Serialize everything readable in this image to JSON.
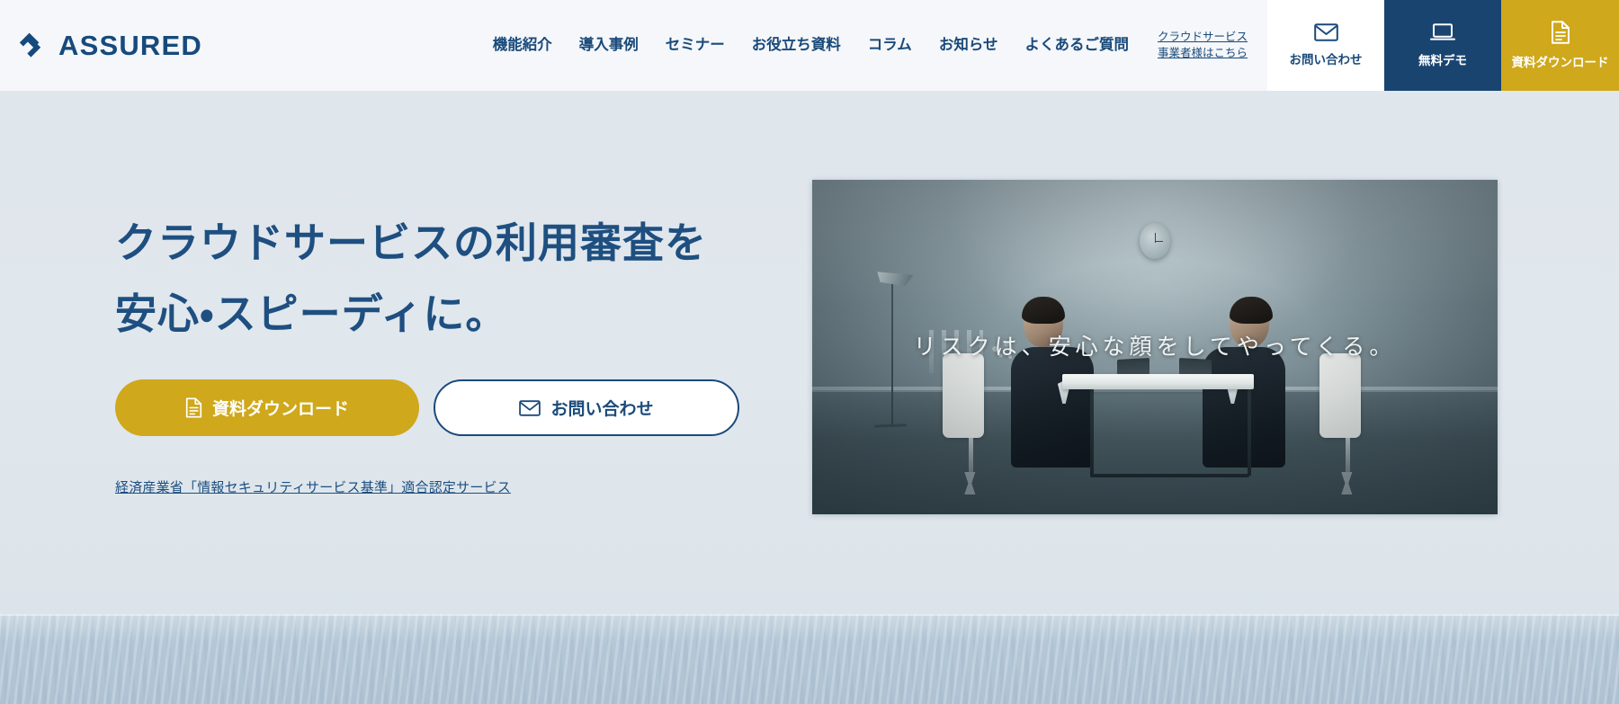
{
  "header": {
    "logo": {
      "text": "ASSURED",
      "mark_icon": "assured-chevron-logo-icon",
      "color": "#174a7c"
    },
    "nav_items": [
      {
        "label": "機能紹介"
      },
      {
        "label": "導入事例"
      },
      {
        "label": "セミナー"
      },
      {
        "label": "お役立ち資料"
      },
      {
        "label": "コラム"
      },
      {
        "label": "お知らせ"
      },
      {
        "label": "よくあるご質問"
      }
    ],
    "provider_link": {
      "line1": "クラウドサービス",
      "line2": "事業者様はこちら"
    },
    "cta_buttons": [
      {
        "label": "お問い合わせ",
        "icon": "envelope-icon",
        "bg": "#ffffff",
        "fg": "#1a4a7a"
      },
      {
        "label": "無料デモ",
        "icon": "laptop-icon",
        "bg": "#194470",
        "fg": "#ffffff"
      },
      {
        "label": "資料ダウンロード",
        "icon": "document-icon",
        "bg": "#cfa81b",
        "fg": "#ffffff"
      }
    ]
  },
  "hero": {
    "title_line1": "クラウドサービスの利用審査を",
    "title_line2": "安心・スピーディに。",
    "title_color": "#1e4f80",
    "buttons": [
      {
        "label": "資料ダウンロード",
        "icon": "document-icon",
        "style": "gold",
        "bg": "#cfa81b"
      },
      {
        "label": "お問い合わせ",
        "icon": "envelope-icon",
        "style": "outline",
        "border": "#1a4a7a"
      }
    ],
    "cert_link": "経済産業省「情報セキュリティサービス基準」適合認定サービス",
    "video": {
      "caption": "リスクは、安心な顔をしてやってくる。",
      "scene_description": "二人のビジネスマンが白いテーブルでノートPCを挟んで向かい合う、薄暗い会議室"
    }
  }
}
